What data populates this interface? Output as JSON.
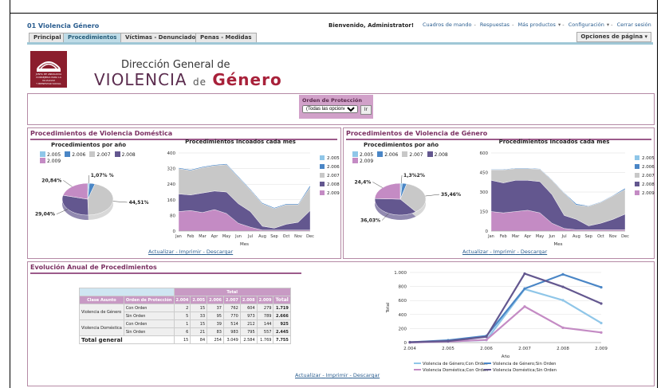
{
  "app": {
    "title": "01 Violencia Género"
  },
  "header": {
    "welcome": "Bienvenido, Administrator!",
    "nav": [
      "Cuadros de mando",
      "Respuestas",
      "Más productos",
      "Configuración",
      "Cerrar sesión"
    ],
    "page_options": "Opciones de página"
  },
  "tabs": [
    "Principal",
    "Procedimientos",
    "Víctimas - Denunciados",
    "Penas - Medidas"
  ],
  "logo": {
    "line1": "JUNTA DE ANDALUCIA",
    "line2": "CONSEJERIA PARA LA IGUALDAD",
    "line3": "Y BIENESTAR SOCIAL",
    "dg": "Dirección General de",
    "vdg1": "VIOLENCIA",
    "vdg2": "de",
    "vdg3": "Género"
  },
  "filter": {
    "label": "Orden de Protección",
    "value": "(Todas las opciones)",
    "go": "Ir"
  },
  "links": {
    "actualizar": "Actualizar",
    "imprimir": "Imprimir",
    "descargar": "Descargar",
    "sep": " - "
  },
  "colors": {
    "y2005": "#8fc6e8",
    "y2006": "#4a86c6",
    "y2007": "#c8c8c8",
    "y2008": "#63578f",
    "y2009": "#c48bc4"
  },
  "sections": {
    "domestica": "Procedimientos de Violencia Doméstica",
    "genero": "Procedimientos de Violencia de Género",
    "anual": "Evolución Anual de Procedimientos"
  },
  "chart_data": [
    {
      "type": "pie",
      "title": "Procedimientos por año",
      "legend": [
        "2.005",
        "2.006",
        "2.007",
        "2.008",
        "2.009"
      ],
      "values": [
        1.07,
        3.5,
        44.51,
        29.04,
        20.84
      ],
      "labels": [
        "1,07% %",
        "",
        "44,51%",
        "29,04%",
        "20,84%"
      ]
    },
    {
      "type": "area",
      "title": "Procedimientos Incoados cada mes",
      "xlabel": "Mes",
      "categories": [
        "Jan",
        "Feb",
        "Mar",
        "Apr",
        "May",
        "Jun",
        "Jul",
        "Aug",
        "Sep",
        "Oct",
        "Nov",
        "Dec"
      ],
      "ylim": [
        0,
        400
      ],
      "yticks": [
        "0",
        "80",
        "160",
        "240",
        "320",
        "400"
      ],
      "legend": [
        "2.005",
        "2.006",
        "2.007",
        "2.008",
        "2.009"
      ],
      "series": [
        {
          "name": "2.009",
          "values": [
            100,
            105,
            95,
            110,
            90,
            40,
            20,
            5,
            5,
            5,
            5,
            5
          ]
        },
        {
          "name": "2.008",
          "values": [
            90,
            80,
            100,
            95,
            110,
            100,
            80,
            20,
            10,
            30,
            40,
            100
          ]
        },
        {
          "name": "2.007",
          "values": [
            130,
            125,
            130,
            130,
            140,
            135,
            110,
            115,
            100,
            100,
            90,
            120
          ]
        },
        {
          "name": "2.006",
          "values": [
            5,
            5,
            5,
            5,
            5,
            5,
            5,
            5,
            5,
            5,
            5,
            10
          ]
        },
        {
          "name": "2.005",
          "values": [
            0,
            0,
            0,
            0,
            0,
            0,
            0,
            0,
            0,
            0,
            0,
            0
          ]
        }
      ]
    },
    {
      "type": "pie",
      "title": "Procedimientos por año",
      "legend": [
        "2.005",
        "2.006",
        "2.007",
        "2.008",
        "2.009"
      ],
      "values": [
        1.3,
        2.8,
        35.46,
        36.03,
        24.4
      ],
      "labels": [
        "1,3%2%",
        "",
        "35,46%",
        "36,03%",
        "24,4%"
      ]
    },
    {
      "type": "area",
      "title": "Procedimientos Incoados cada mes",
      "xlabel": "Mes",
      "categories": [
        "Jan",
        "Feb",
        "Mar",
        "Apr",
        "May",
        "Jun",
        "Jul",
        "Aug",
        "Sep",
        "Oct",
        "Nov",
        "Dec"
      ],
      "ylim": [
        0,
        600
      ],
      "yticks": [
        "0",
        "150",
        "300",
        "450",
        "600"
      ],
      "legend": [
        "2.005",
        "2.006",
        "2.007",
        "2.008",
        "2.009"
      ],
      "series": [
        {
          "name": "2.009",
          "values": [
            150,
            140,
            150,
            160,
            140,
            60,
            20,
            10,
            10,
            10,
            10,
            10
          ]
        },
        {
          "name": "2.008",
          "values": [
            240,
            230,
            240,
            230,
            240,
            220,
            100,
            80,
            30,
            50,
            80,
            120
          ]
        },
        {
          "name": "2.007",
          "values": [
            80,
            100,
            90,
            90,
            95,
            110,
            170,
            110,
            150,
            160,
            180,
            190
          ]
        },
        {
          "name": "2.006",
          "values": [
            5,
            5,
            5,
            5,
            5,
            5,
            5,
            10,
            5,
            5,
            5,
            10
          ]
        },
        {
          "name": "2.005",
          "values": [
            0,
            0,
            0,
            0,
            0,
            0,
            0,
            0,
            0,
            0,
            0,
            0
          ]
        }
      ]
    },
    {
      "type": "table",
      "title": "Total",
      "columns": [
        "Clase Asunto",
        "Orden de Protección",
        "2.004",
        "2.005",
        "2.006",
        "2.007",
        "2.008",
        "2.009",
        "Total"
      ],
      "rows": [
        [
          "Violencia de Género",
          "Con Orden",
          "2",
          "15",
          "37",
          "762",
          "604",
          "279",
          "1.719"
        ],
        [
          "",
          "Sin Orden",
          "5",
          "33",
          "95",
          "770",
          "973",
          "789",
          "2.666"
        ],
        [
          "Violencia Doméstica",
          "Con Orden",
          "1",
          "15",
          "39",
          "514",
          "212",
          "144",
          "925"
        ],
        [
          "",
          "Sin Orden",
          "6",
          "21",
          "83",
          "983",
          "795",
          "557",
          "2.445"
        ],
        [
          "Total general",
          "",
          "15",
          "84",
          "254",
          "3.049",
          "2.584",
          "1.769",
          "7.755"
        ]
      ]
    },
    {
      "type": "line",
      "xlabel": "Año",
      "ylabel": "Total",
      "categories": [
        "2.004",
        "2.005",
        "2.006",
        "2.007",
        "2.008",
        "2.009"
      ],
      "ylim": [
        0,
        1000
      ],
      "yticks": [
        "0",
        "200",
        "400",
        "600",
        "800",
        "1.000"
      ],
      "series": [
        {
          "name": "Violencia de Género;Con Orden",
          "color": "#8fc6e8",
          "values": [
            2,
            15,
            37,
            762,
            604,
            279
          ]
        },
        {
          "name": "Violencia de Género;Sin Orden",
          "color": "#4a86c6",
          "values": [
            5,
            33,
            95,
            770,
            973,
            789
          ]
        },
        {
          "name": "Violencia Doméstica;Con Orden",
          "color": "#c48bc4",
          "values": [
            1,
            15,
            39,
            514,
            212,
            144
          ]
        },
        {
          "name": "Violencia Doméstica;Sin Orden",
          "color": "#63578f",
          "values": [
            6,
            21,
            83,
            983,
            795,
            557
          ]
        }
      ]
    }
  ]
}
